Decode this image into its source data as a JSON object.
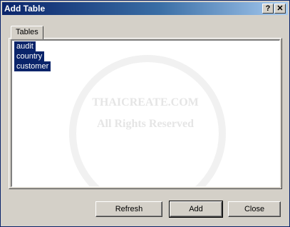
{
  "window": {
    "title": "Add Table",
    "help_glyph": "?",
    "close_glyph": "✕"
  },
  "tabs": [
    {
      "label": "Tables"
    }
  ],
  "table_list": {
    "items": [
      "audit",
      "country",
      "customer"
    ]
  },
  "watermark": {
    "line1": "THAICREATE.COM",
    "line2": "All Rights Reserved"
  },
  "buttons": {
    "refresh": "Refresh",
    "add": "Add",
    "close": "Close"
  },
  "colors": {
    "titlebar_start": "#0a246a",
    "selection": "#0a246a",
    "face": "#d4d0c8"
  }
}
